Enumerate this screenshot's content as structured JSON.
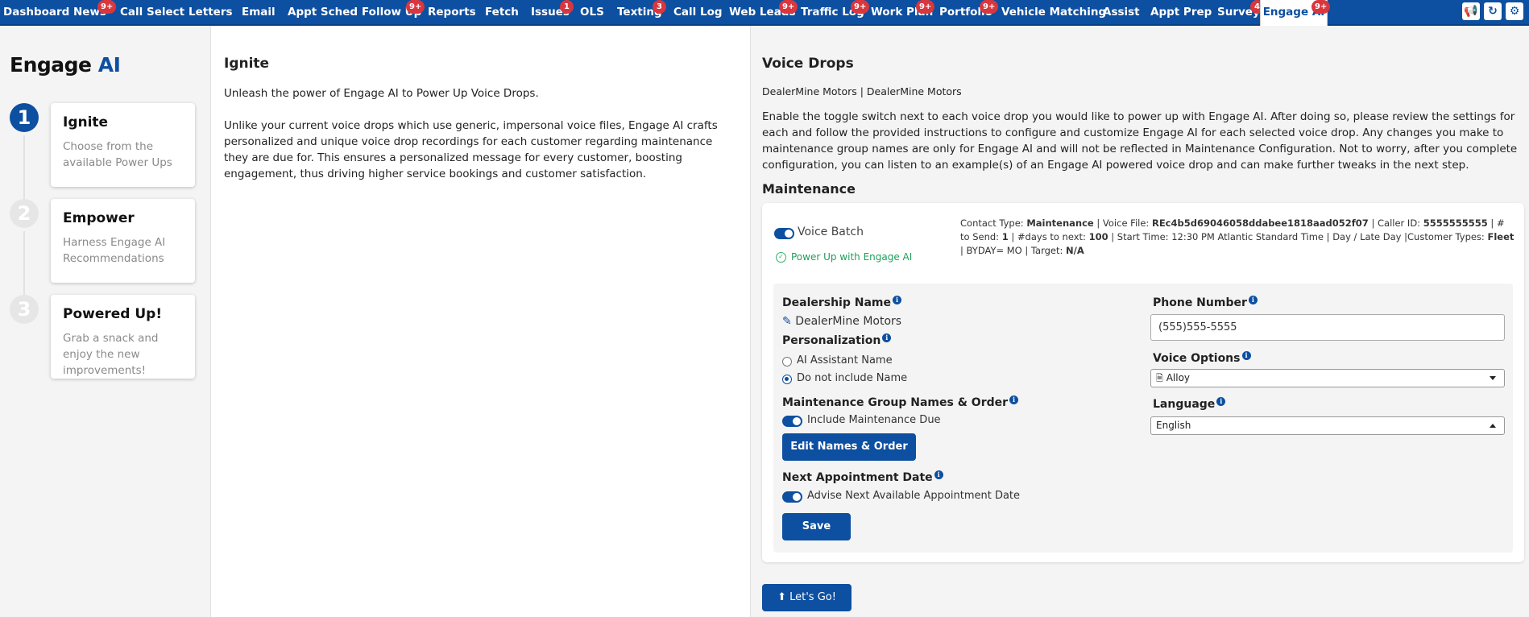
{
  "nav": {
    "items": [
      {
        "label": "Dashboard"
      },
      {
        "label": "News",
        "badge": "9+"
      },
      {
        "label": "Call Select"
      },
      {
        "label": "Letters"
      },
      {
        "label": "Email"
      },
      {
        "label": "Appt Sched"
      },
      {
        "label": "Follow Up",
        "badge": "9+"
      },
      {
        "label": "Reports"
      },
      {
        "label": "Fetch"
      },
      {
        "label": "Issues",
        "badge": "1"
      },
      {
        "label": "OLS"
      },
      {
        "label": "Texting",
        "badge": "3"
      },
      {
        "label": "Call Log"
      },
      {
        "label": "Web Leads",
        "badge": "9+"
      },
      {
        "label": "Traffic Log",
        "badge": "9+"
      },
      {
        "label": "Work Plan",
        "badge": "9+"
      },
      {
        "label": "Portfolio",
        "badge": "9+"
      },
      {
        "label": "Vehicle Matching"
      },
      {
        "label": "Assist"
      },
      {
        "label": "Appt Prep"
      },
      {
        "label": "Survey",
        "badge": "4"
      },
      {
        "label": "Engage AI",
        "badge": "9+"
      }
    ]
  },
  "sidebar": {
    "brand_main": "Engage",
    "brand_accent": "AI",
    "steps": [
      {
        "num": "1",
        "title": "Ignite",
        "desc": "Choose from the available Power Ups"
      },
      {
        "num": "2",
        "title": "Empower",
        "desc": "Harness Engage AI Recommendations"
      },
      {
        "num": "3",
        "title": "Powered Up!",
        "desc": "Grab a snack and enjoy the new improvements!"
      }
    ]
  },
  "ignite": {
    "title": "Ignite",
    "p1": "Unleash the power of Engage AI to Power Up Voice Drops.",
    "p2": "Unlike your current voice drops which use generic, impersonal voice files, Engage AI crafts personalized and unique voice drop recordings for each customer regarding maintenance they are due for. This ensures a personalized message for every customer, boosting engagement, thus driving higher service bookings and customer satisfaction."
  },
  "voice_drops": {
    "title": "Voice Drops",
    "dealer_line": "DealerMine Motors | DealerMine Motors",
    "description": "Enable the toggle switch next to each voice drop you would like to power up with Engage AI. After doing so, please review the settings for each and follow the provided instructions to configure and customize Engage AI for each selected voice drop. Any changes you make to maintenance group names are only for Engage AI and will not be reflected in Maintenance Configuration. Not to worry, after you complete configuration, you can listen to an example(s) of an Engage AI powered voice drop and can make further tweaks in the next step.",
    "section_title": "Maintenance",
    "batch": {
      "label": "Voice Batch",
      "power_up": "Power Up with Engage AI",
      "info": {
        "contact_type_label": "Contact Type:",
        "contact_type": "Maintenance",
        "voice_file_label": "Voice File:",
        "voice_file": "REc4b5d69046058ddabee1818aad052f07",
        "caller_id_label": "Caller ID:",
        "caller_id": "5555555555",
        "to_send_label": "# to Send:",
        "to_send": "1",
        "days_label": "#days to next:",
        "days": "100",
        "start_time": "Start Time: 12:30 PM Atlantic Standard Time",
        "day_type": "Day / Late Day",
        "customer_types_label": "Customer Types:",
        "customer_types": "Fleet",
        "byday": "BYDAY= MO",
        "target_label": "Target:",
        "target": "N/A"
      }
    },
    "form": {
      "dealership_name_label": "Dealership Name",
      "dealership_name": "DealerMine Motors",
      "personalization_label": "Personalization",
      "radio_ai_name": "AI Assistant Name",
      "radio_no_name": "Do not include Name",
      "mgn_label": "Maintenance Group Names & Order",
      "include_maint": "Include Maintenance Due",
      "edit_button": "Edit Names & Order",
      "next_appt_label": "Next Appointment Date",
      "advise_next": "Advise Next Available Appointment Date",
      "save_button": "Save",
      "phone_label": "Phone Number",
      "phone_value": "(555)555-5555",
      "voice_options_label": "Voice Options",
      "voice_option": "Alloy",
      "language_label": "Language",
      "language": "English"
    },
    "lets_go": "Let's Go!"
  },
  "colors": {
    "brand": "#0d4fa0",
    "badge": "#d9363e",
    "success": "#1ea05a"
  }
}
